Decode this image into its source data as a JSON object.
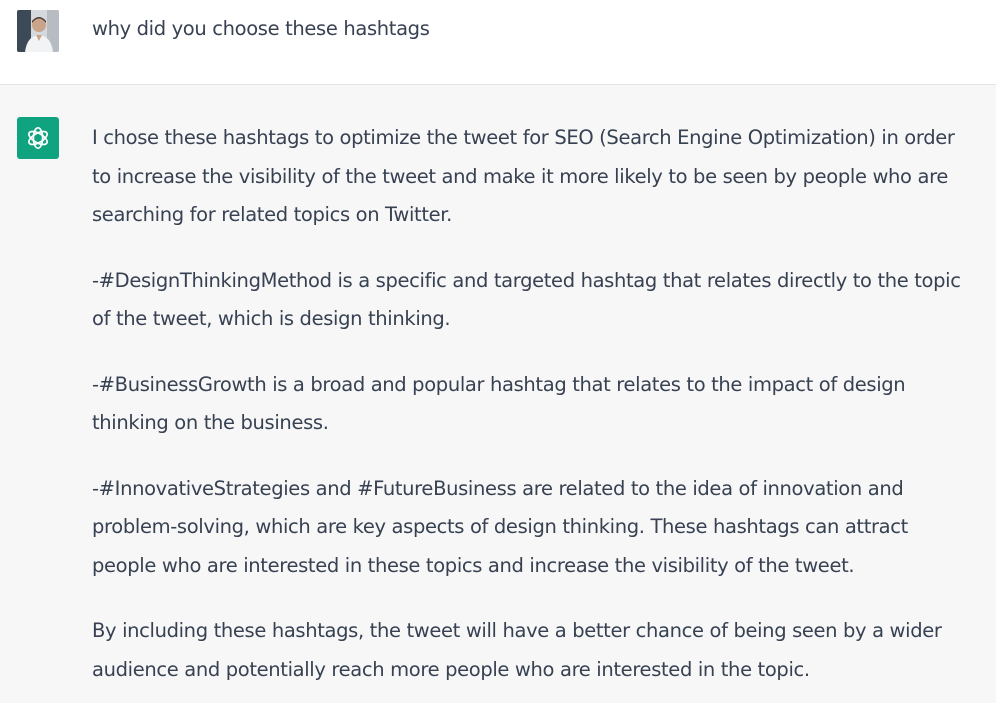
{
  "conversation": {
    "user_message": {
      "avatar": "user-photo-avatar",
      "text": "why did you choose these hashtags"
    },
    "assistant_message": {
      "avatar": "openai-logo-icon",
      "accent_color": "#10a37f",
      "paragraphs": [
        {
          "lines": [
            "I chose these hashtags to optimize the tweet for SEO (Search Engine Optimization) in order",
            "to increase the visibility of the tweet and make it more likely to be seen by people who are",
            "searching for related topics on Twitter."
          ]
        },
        {
          "lines": [
            "-#DesignThinkingMethod is a specific and targeted hashtag that relates directly to the topic",
            "of the tweet, which is design thinking."
          ]
        },
        {
          "lines": [
            "-#BusinessGrowth is a broad and popular hashtag that relates to the impact of design",
            "thinking on the business."
          ]
        },
        {
          "lines": [
            "-#InnovativeStrategies and #FutureBusiness are related to the idea of innovation and",
            "problem-solving, which are key aspects of design thinking. These hashtags can attract",
            "people who are interested in these topics and increase the visibility of the tweet."
          ]
        },
        {
          "lines": [
            "By including these hashtags, the tweet will have a better chance of being seen by a wider",
            "audience and potentially reach more people who are interested in the topic."
          ]
        }
      ]
    }
  }
}
